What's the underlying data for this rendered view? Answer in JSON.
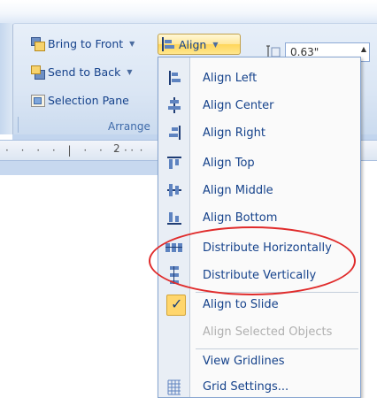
{
  "ribbon": {
    "bring_to_front": "Bring to Front",
    "send_to_back": "Send to Back",
    "selection_pane": "Selection Pane",
    "align_button": "Align",
    "group_label": "Arrange",
    "size_value": "0.63\"",
    "ruler_mark": "2"
  },
  "align_menu": {
    "items": [
      {
        "label": "Align Left",
        "icon": "align-left-icon",
        "enabled": true
      },
      {
        "label": "Align Center",
        "icon": "align-center-icon",
        "enabled": true
      },
      {
        "label": "Align Right",
        "icon": "align-right-icon",
        "enabled": true
      },
      {
        "label": "Align Top",
        "icon": "align-top-icon",
        "enabled": true
      },
      {
        "label": "Align Middle",
        "icon": "align-middle-icon",
        "enabled": true
      },
      {
        "label": "Align Bottom",
        "icon": "align-bottom-icon",
        "enabled": true
      },
      {
        "label": "Distribute Horizontally",
        "icon": "distribute-horizontally-icon",
        "enabled": true
      },
      {
        "label": "Distribute Vertically",
        "icon": "distribute-vertically-icon",
        "enabled": true
      },
      {
        "label": "Align to Slide",
        "icon": "checkmark-icon",
        "enabled": true,
        "checked": true
      },
      {
        "label": "Align Selected Objects",
        "icon": "",
        "enabled": false
      },
      {
        "label": "View Gridlines",
        "icon": "",
        "enabled": true
      },
      {
        "label": "Grid Settings...",
        "icon": "grid-icon",
        "enabled": true
      }
    ]
  },
  "colors": {
    "menu_text": "#15428b",
    "highlight_ellipse": "#e02b2b",
    "checked_bg": "#ffd66d"
  }
}
